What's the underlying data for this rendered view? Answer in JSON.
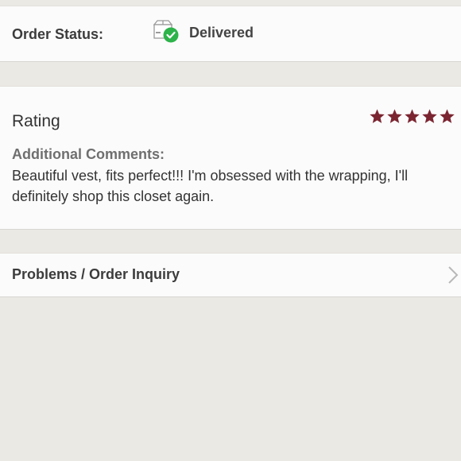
{
  "order_status": {
    "label": "Order Status:",
    "value": "Delivered",
    "icon": "box-delivered-icon",
    "check_color": "#2db34a"
  },
  "review": {
    "rating_title": "Rating",
    "stars": 5,
    "star_max": 5,
    "star_color": "#7b2531",
    "comments_label": "Additional Comments:",
    "comments_text": "Beautiful vest, fits perfect!!! I'm obsessed with the wrapping, I'll definitely shop this closet again."
  },
  "inquiry": {
    "label": "Problems / Order Inquiry",
    "icon": "chevron-right-icon"
  }
}
